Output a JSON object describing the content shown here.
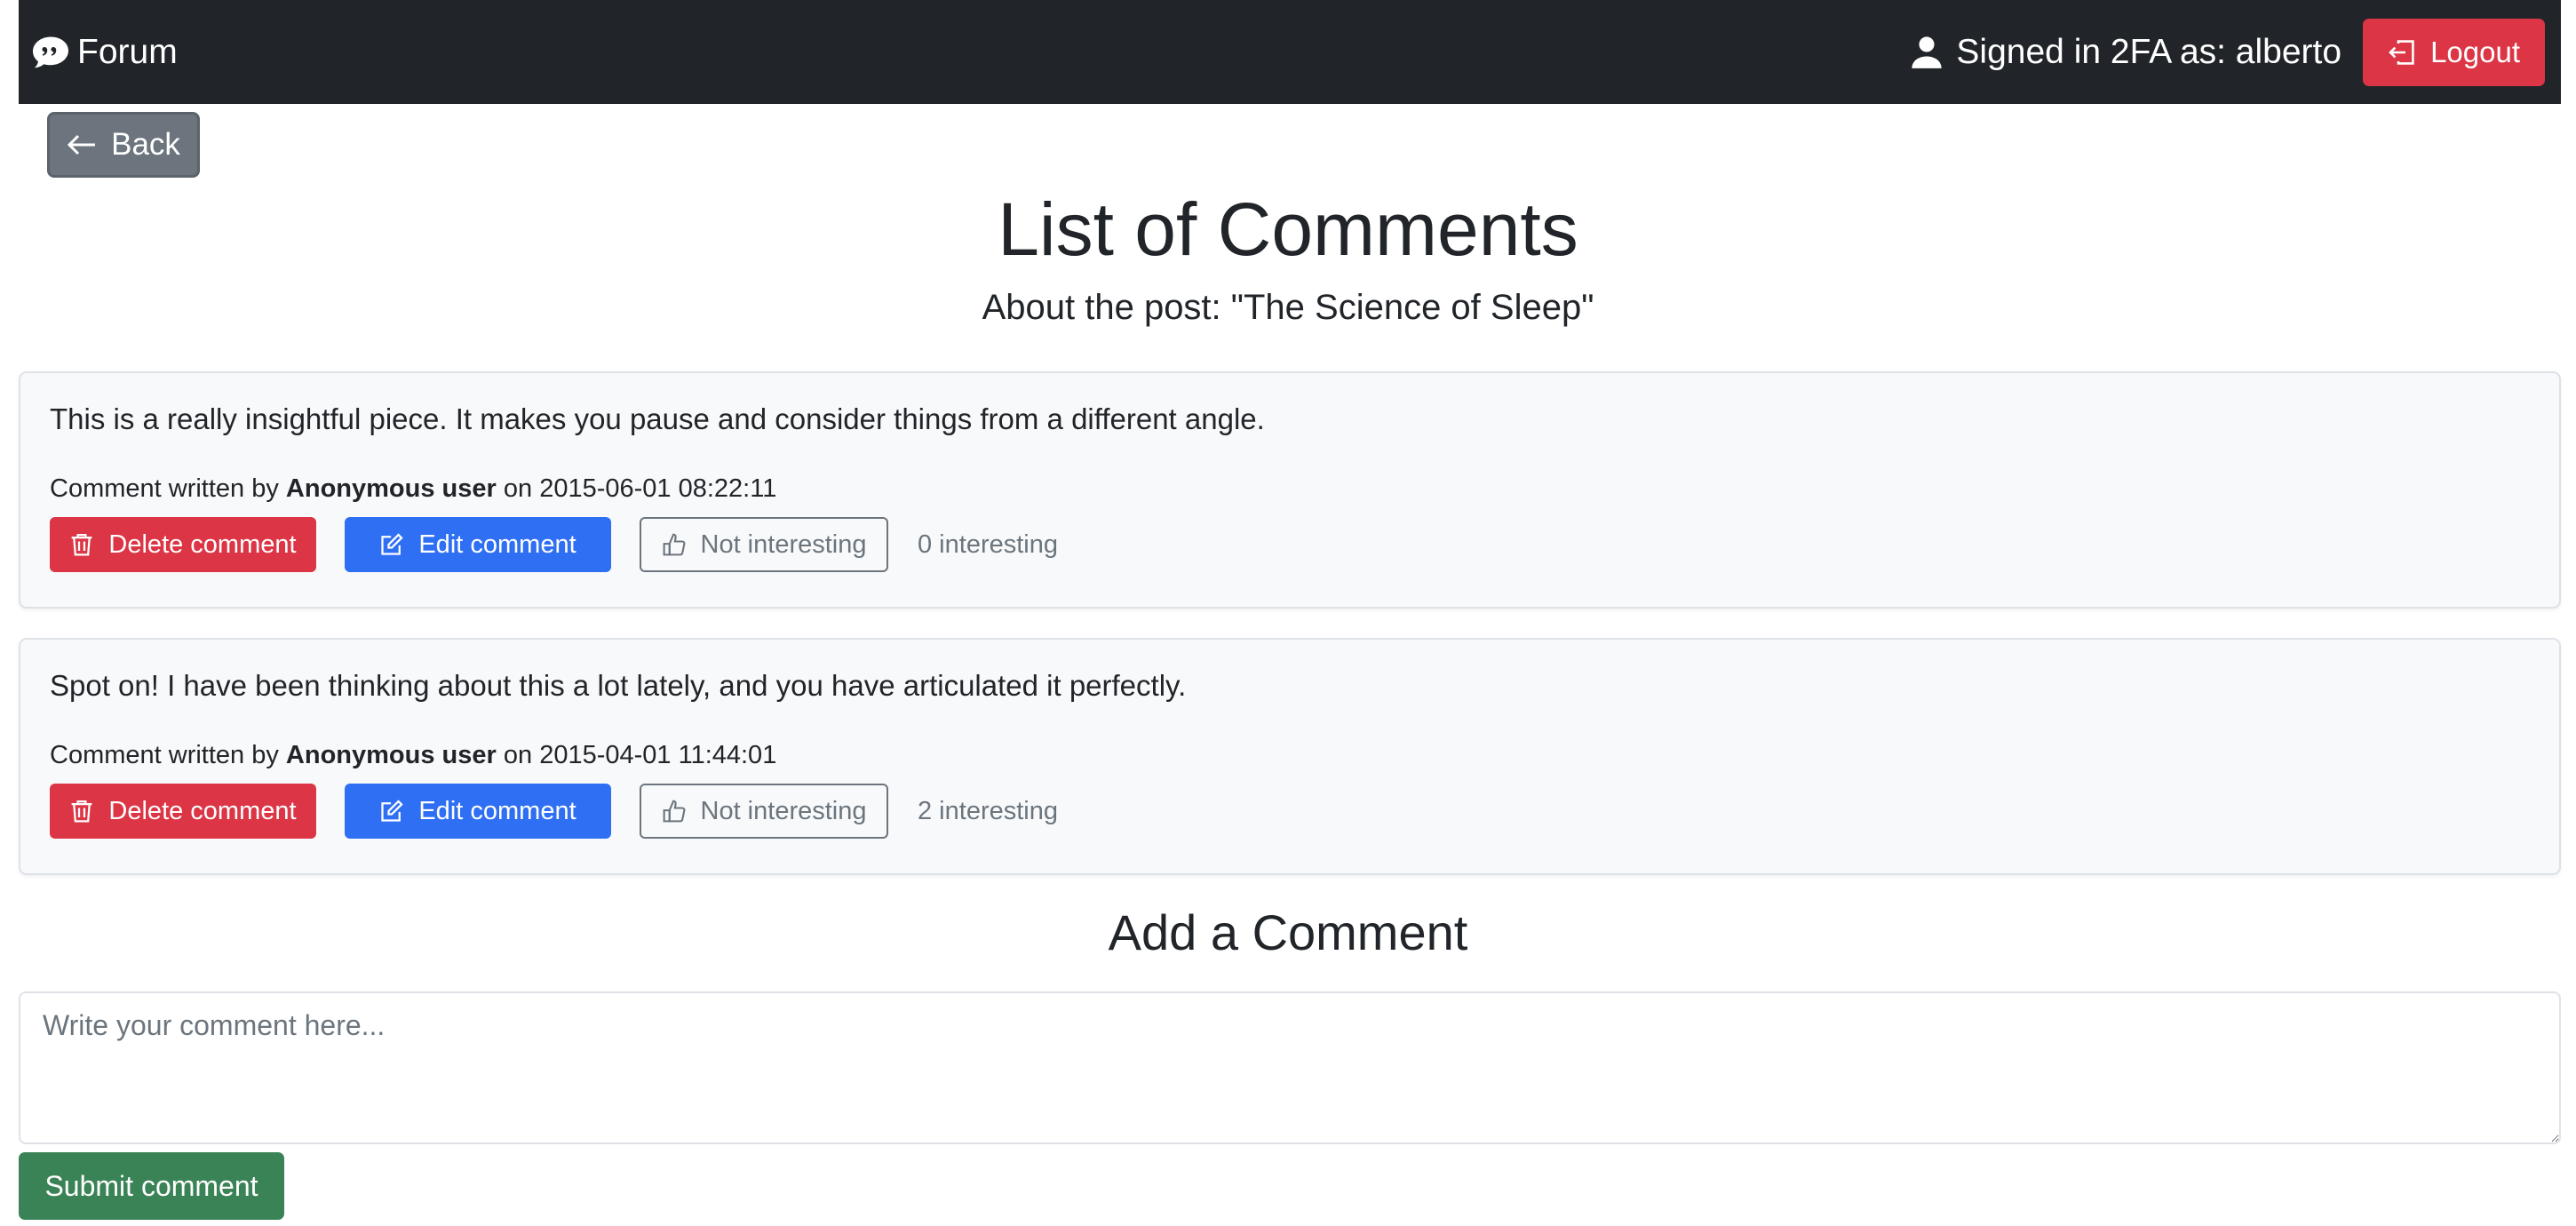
{
  "navbar": {
    "brand": "Forum",
    "user_status": "Signed in 2FA as: alberto",
    "logout_label": "Logout"
  },
  "back_label": "Back",
  "page_title": "List of Comments",
  "page_subtitle": "About the post: \"The Science of Sleep\"",
  "comments": [
    {
      "text": "This is a really insightful piece. It makes you pause and consider things from a different angle.",
      "meta_prefix": "Comment written by",
      "author": "Anonymous user",
      "meta_on": "on",
      "date": "2015-06-01 08:22:11",
      "delete_label": "Delete comment",
      "edit_label": "Edit comment",
      "vote_label": "Not interesting",
      "count": "0 interesting"
    },
    {
      "text": "Spot on! I have been thinking about this a lot lately, and you have articulated it perfectly.",
      "meta_prefix": "Comment written by",
      "author": "Anonymous user",
      "meta_on": "on",
      "date": "2015-04-01 11:44:01",
      "delete_label": "Delete comment",
      "edit_label": "Edit comment",
      "vote_label": "Not interesting",
      "count": "2 interesting"
    }
  ],
  "add_comment": {
    "title": "Add a Comment",
    "placeholder": "Write your comment here...",
    "value": "",
    "submit_label": "Submit comment"
  },
  "colors": {
    "navbar_bg": "#212529",
    "danger": "#dc3545",
    "primary": "#2f6ff3",
    "secondary": "#6c757d",
    "success": "#3a8356",
    "card_bg": "#f8f9fa"
  },
  "icons": {
    "brand": "chat-quote-icon",
    "user": "person-icon",
    "logout": "box-arrow-left-icon",
    "back": "arrow-left-icon",
    "delete": "trash-icon",
    "edit": "pencil-square-icon",
    "vote": "hand-thumbs-up-icon"
  }
}
